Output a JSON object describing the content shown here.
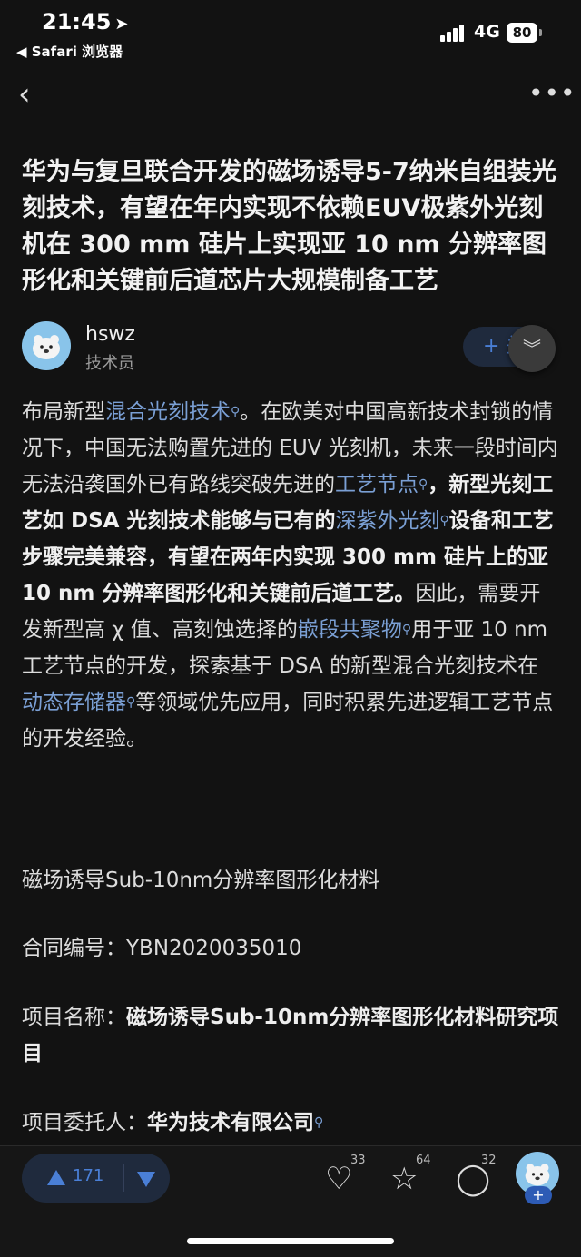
{
  "status_bar": {
    "time": "21:45",
    "back_app": "◀ Safari 浏览器",
    "network": "4G",
    "battery": "80"
  },
  "nav": {
    "back_icon": "‹",
    "more_icon": "•••"
  },
  "article": {
    "title": "华为与复旦联合开发的磁场诱导5-7纳米自组装光刻技术，有望在年内实现不依赖EUV极紫外光刻机在 300 mm 硅片上实现亚 10 nm 分辨率图形化和关键前后道芯片大规模制备工艺",
    "author": {
      "name": "hswz",
      "role": "技术员",
      "follow_label": "+ 关注"
    },
    "paragraph": [
      {
        "t": "布局新型"
      },
      {
        "t": "混合光刻技术",
        "link": true
      },
      {
        "t": "。在欧美对中国高新技术封锁的情况下，中国无法购置先进的 EUV 光刻机，未来一段时间内无法沿袭国外已有路线突破先进的"
      },
      {
        "t": "工艺节点",
        "link": true
      },
      {
        "t": "，新型光刻工艺如 DSA 光刻技术能够与已有的",
        "bold": true
      },
      {
        "t": "深紫外光刻",
        "link": true
      },
      {
        "t": "设备和工艺步骤完美兼容，有望在两年内实现 300 mm 硅片上的亚 10 nm 分辨率图形化和关键前后道工艺。",
        "bold": true
      },
      {
        "t": "因此，需要开发新型高 χ 值、高刻蚀选择的"
      },
      {
        "t": "嵌段共聚物",
        "link": true
      },
      {
        "t": "用于亚 10 nm 工艺节点的开发，探索基于 DSA 的新型混合光刻技术在"
      },
      {
        "t": "动态存储器",
        "link": true
      },
      {
        "t": "等领域优先应用，同时积累先进逻辑工艺节点的开发经验。"
      }
    ],
    "lines": {
      "material": "磁场诱导Sub-10nm分辨率图形化材料",
      "contract_label": "合同编号：",
      "contract_value": "YBN2020035010",
      "project_label": "项目名称：",
      "project_value": "磁场诱导Sub-10nm分辨率图形化材料研究项目",
      "client_label": "项目委托人：",
      "client_value": "华为技术有限公司"
    }
  },
  "bottom_bar": {
    "upvotes": "171",
    "likes": "33",
    "favorites": "64",
    "comments": "32",
    "plus": "+"
  },
  "colors": {
    "accent": "#4a7fd6",
    "link": "#7a9fd4",
    "background": "#121212"
  }
}
